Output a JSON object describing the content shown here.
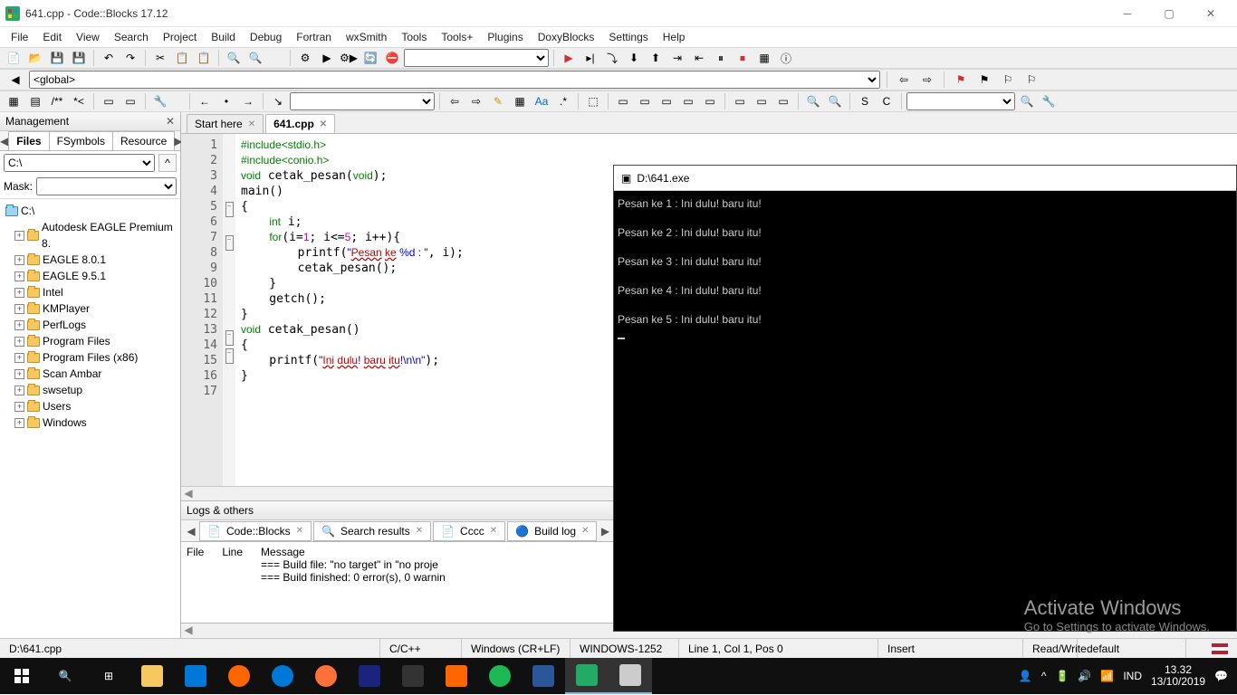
{
  "title": "641.cpp - Code::Blocks 17.12",
  "menus": [
    "File",
    "Edit",
    "View",
    "Search",
    "Project",
    "Build",
    "Debug",
    "Fortran",
    "wxSmith",
    "Tools",
    "Tools+",
    "Plugins",
    "DoxyBlocks",
    "Settings",
    "Help"
  ],
  "scope": "<global>",
  "management": {
    "title": "Management",
    "tabs": [
      "Files",
      "FSymbols",
      "Resource"
    ],
    "activeTab": "Files",
    "drive": "C:\\",
    "maskLabel": "Mask:",
    "tree": [
      {
        "label": "C:\\",
        "open": true,
        "root": true
      },
      {
        "label": "Autodesk EAGLE Premium 8."
      },
      {
        "label": "EAGLE 8.0.1"
      },
      {
        "label": "EAGLE 9.5.1"
      },
      {
        "label": "Intel"
      },
      {
        "label": "KMPlayer"
      },
      {
        "label": "PerfLogs"
      },
      {
        "label": "Program Files"
      },
      {
        "label": "Program Files (x86)"
      },
      {
        "label": "Scan Ambar"
      },
      {
        "label": "swsetup"
      },
      {
        "label": "Users"
      },
      {
        "label": "Windows"
      }
    ]
  },
  "editor": {
    "tabs": [
      {
        "label": "Start here",
        "active": false
      },
      {
        "label": "641.cpp",
        "active": true
      }
    ],
    "lines": 17
  },
  "logs": {
    "title": "Logs & others",
    "tabs": [
      "Code::Blocks",
      "Search results",
      "Cccc",
      "Build log"
    ],
    "headers": [
      "File",
      "Line",
      "Message"
    ],
    "rows": [
      "=== Build file: \"no target\" in \"no proje",
      "=== Build finished: 0 error(s), 0 warnin"
    ]
  },
  "status": {
    "path": "D:\\641.cpp",
    "lang": "C/C++",
    "eol": "Windows (CR+LF)",
    "enc": "WINDOWS-1252",
    "pos": "Line 1, Col 1, Pos 0",
    "ins": "Insert",
    "rw": "Read/Write",
    "def": "default"
  },
  "console": {
    "title": "D:\\641.exe",
    "lines": [
      "Pesan ke 1 : Ini dulu! baru itu!",
      "",
      "Pesan ke 2 : Ini dulu! baru itu!",
      "",
      "Pesan ke 3 : Ini dulu! baru itu!",
      "",
      "Pesan ke 4 : Ini dulu! baru itu!",
      "",
      "Pesan ke 5 : Ini dulu! baru itu!"
    ]
  },
  "watermark": {
    "h": "Activate Windows",
    "p": "Go to Settings to activate Windows."
  },
  "tray": {
    "lang": "IND",
    "time": "13.32",
    "date": "13/10/2019"
  }
}
